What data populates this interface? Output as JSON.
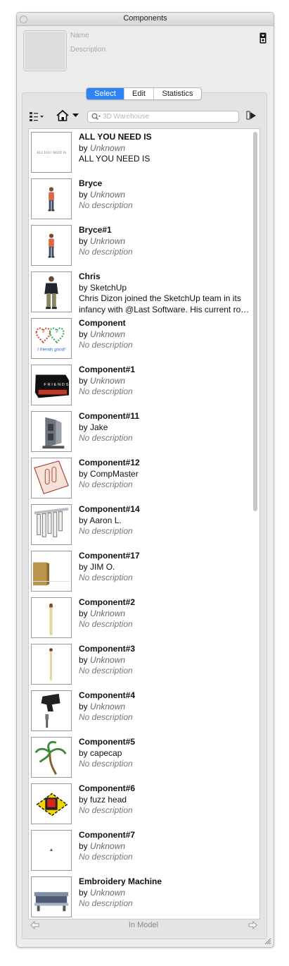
{
  "window": {
    "title": "Components"
  },
  "header": {
    "name_placeholder": "Name",
    "description_placeholder": "Description"
  },
  "tabs": [
    {
      "label": "Select",
      "active": true
    },
    {
      "label": "Edit",
      "active": false
    },
    {
      "label": "Statistics",
      "active": false
    }
  ],
  "toolbar": {
    "view_options_icon": "grid-list-icon",
    "home_icon": "house-icon",
    "details_icon": "details-arrow-icon",
    "search": {
      "placeholder": "3D Warehouse",
      "value": ""
    }
  },
  "colors": {
    "accent": "#2d82f5"
  },
  "components": [
    {
      "name": "ALL YOU NEED IS",
      "by": "by",
      "author": "Unknown",
      "author_italic": true,
      "description": "ALL YOU NEED IS",
      "description_italic": false,
      "thumb": "text-logo"
    },
    {
      "name": "Bryce",
      "by": "by",
      "author": "Unknown",
      "author_italic": true,
      "description": "No description",
      "description_italic": true,
      "thumb": "person"
    },
    {
      "name": "Bryce#1",
      "by": "by",
      "author": "Unknown",
      "author_italic": true,
      "description": "No description",
      "description_italic": true,
      "thumb": "person"
    },
    {
      "name": "Chris",
      "by": "by",
      "author": "SketchUp",
      "author_italic": false,
      "description": "Chris Dizon joined the SketchUp team in its infancy with @Last Software. His current ro…",
      "description_italic": false,
      "thumb": "person-dark"
    },
    {
      "name": "Component",
      "by": "by",
      "author": "Unknown",
      "author_italic": true,
      "description": "No description",
      "description_italic": true,
      "thumb": "friends-hearts"
    },
    {
      "name": "Component#1",
      "by": "by",
      "author": "Unknown",
      "author_italic": true,
      "description": "No description",
      "description_italic": true,
      "thumb": "black-box"
    },
    {
      "name": "Component#11",
      "by": "by",
      "author": "Jake",
      "author_italic": false,
      "description": "No description",
      "description_italic": true,
      "thumb": "machine"
    },
    {
      "name": "Component#12",
      "by": "by",
      "author": "CompMaster",
      "author_italic": false,
      "description": "No description",
      "description_italic": true,
      "thumb": "tray"
    },
    {
      "name": "Component#14",
      "by": "by",
      "author": "Aaron L.",
      "author_italic": false,
      "description": "No description",
      "description_italic": true,
      "thumb": "rack"
    },
    {
      "name": "Component#17",
      "by": "by",
      "author": "JIM O.",
      "author_italic": false,
      "description": "No description",
      "description_italic": true,
      "thumb": "crate"
    },
    {
      "name": "Component#2",
      "by": "by",
      "author": "Unknown",
      "author_italic": true,
      "description": "No description",
      "description_italic": true,
      "thumb": "match"
    },
    {
      "name": "Component#3",
      "by": "by",
      "author": "Unknown",
      "author_italic": true,
      "description": "No description",
      "description_italic": true,
      "thumb": "match-red"
    },
    {
      "name": "Component#4",
      "by": "by",
      "author": "Unknown",
      "author_italic": true,
      "description": "No description",
      "description_italic": true,
      "thumb": "tool"
    },
    {
      "name": "Component#5",
      "by": "by",
      "author": "capecap",
      "author_italic": false,
      "description": "No description",
      "description_italic": true,
      "thumb": "palm"
    },
    {
      "name": "Component#6",
      "by": "by",
      "author": "fuzz head",
      "author_italic": false,
      "description": "No description",
      "description_italic": true,
      "thumb": "chip"
    },
    {
      "name": "Component#7",
      "by": "by",
      "author": "Unknown",
      "author_italic": true,
      "description": "No description",
      "description_italic": true,
      "thumb": "dot"
    },
    {
      "name": "Embroidery Machine",
      "by": "by",
      "author": "Unknown",
      "author_italic": true,
      "description": "No description",
      "description_italic": true,
      "thumb": "embroidery"
    }
  ],
  "footer": {
    "label": "In Model"
  }
}
